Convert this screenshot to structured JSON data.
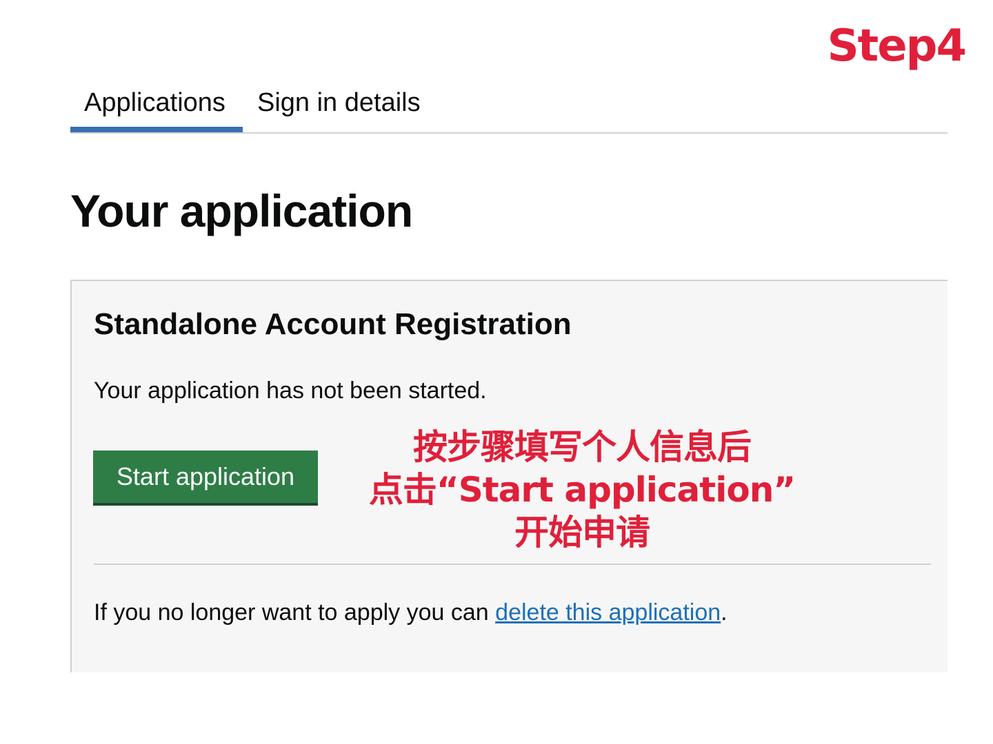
{
  "overlay": {
    "step_label": "Step4",
    "annotation_lines": [
      "按步骤填写个人信息后",
      "点击“Start application”",
      "开始申请"
    ],
    "annotation_color": "#e0203a"
  },
  "tabs": [
    {
      "label": "Applications",
      "active": true
    },
    {
      "label": "Sign in details",
      "active": false
    }
  ],
  "page_title": "Your application",
  "panel": {
    "title": "Standalone Account Registration",
    "status_text": "Your application has not been started.",
    "start_button_label": "Start application",
    "footer_prefix": "If you no longer want to apply you can ",
    "delete_link_label": "delete this application",
    "footer_suffix": "."
  },
  "colors": {
    "tab_active_underline": "#3a6fb3",
    "start_button": "#2e7d46",
    "link": "#1d70b8"
  }
}
